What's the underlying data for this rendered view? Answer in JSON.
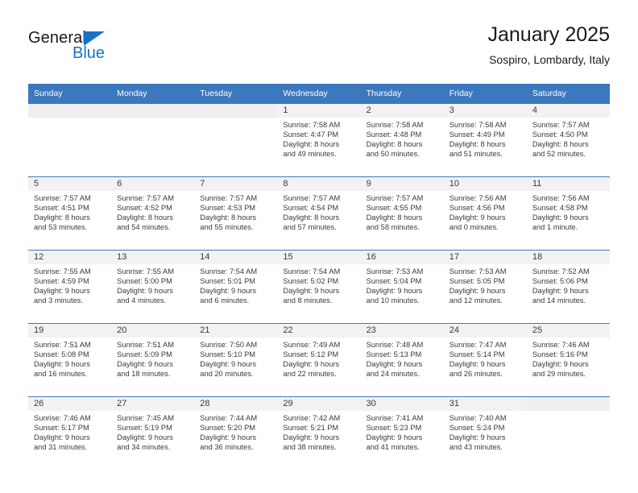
{
  "brand": {
    "name_part1": "General",
    "name_part2": "Blue",
    "triangle_color": "#1a72c4"
  },
  "header": {
    "title": "January 2025",
    "subtitle": "Sospiro, Lombardy, Italy"
  },
  "theme": {
    "header_blue": "#3b78be",
    "daynum_bg": "#f2f2f2",
    "empty_daynum_bg": "#efefef",
    "text": "#3a3a3a"
  },
  "weekdays": [
    "Sunday",
    "Monday",
    "Tuesday",
    "Wednesday",
    "Thursday",
    "Friday",
    "Saturday"
  ],
  "labels": {
    "sunrise_prefix": "Sunrise:",
    "sunset_prefix": "Sunset:",
    "daylight_prefix": "Daylight:"
  },
  "weeks": [
    [
      {
        "day": "",
        "empty": true
      },
      {
        "day": "",
        "empty": true
      },
      {
        "day": "",
        "empty": true
      },
      {
        "day": "1",
        "sunrise": "Sunrise: 7:58 AM",
        "sunset": "Sunset: 4:47 PM",
        "daylight_line1": "Daylight: 8 hours",
        "daylight_line2": "and 49 minutes."
      },
      {
        "day": "2",
        "sunrise": "Sunrise: 7:58 AM",
        "sunset": "Sunset: 4:48 PM",
        "daylight_line1": "Daylight: 8 hours",
        "daylight_line2": "and 50 minutes."
      },
      {
        "day": "3",
        "sunrise": "Sunrise: 7:58 AM",
        "sunset": "Sunset: 4:49 PM",
        "daylight_line1": "Daylight: 8 hours",
        "daylight_line2": "and 51 minutes."
      },
      {
        "day": "4",
        "sunrise": "Sunrise: 7:57 AM",
        "sunset": "Sunset: 4:50 PM",
        "daylight_line1": "Daylight: 8 hours",
        "daylight_line2": "and 52 minutes."
      }
    ],
    [
      {
        "day": "5",
        "sunrise": "Sunrise: 7:57 AM",
        "sunset": "Sunset: 4:51 PM",
        "daylight_line1": "Daylight: 8 hours",
        "daylight_line2": "and 53 minutes."
      },
      {
        "day": "6",
        "sunrise": "Sunrise: 7:57 AM",
        "sunset": "Sunset: 4:52 PM",
        "daylight_line1": "Daylight: 8 hours",
        "daylight_line2": "and 54 minutes."
      },
      {
        "day": "7",
        "sunrise": "Sunrise: 7:57 AM",
        "sunset": "Sunset: 4:53 PM",
        "daylight_line1": "Daylight: 8 hours",
        "daylight_line2": "and 55 minutes."
      },
      {
        "day": "8",
        "sunrise": "Sunrise: 7:57 AM",
        "sunset": "Sunset: 4:54 PM",
        "daylight_line1": "Daylight: 8 hours",
        "daylight_line2": "and 57 minutes."
      },
      {
        "day": "9",
        "sunrise": "Sunrise: 7:57 AM",
        "sunset": "Sunset: 4:55 PM",
        "daylight_line1": "Daylight: 8 hours",
        "daylight_line2": "and 58 minutes."
      },
      {
        "day": "10",
        "sunrise": "Sunrise: 7:56 AM",
        "sunset": "Sunset: 4:56 PM",
        "daylight_line1": "Daylight: 9 hours",
        "daylight_line2": "and 0 minutes."
      },
      {
        "day": "11",
        "sunrise": "Sunrise: 7:56 AM",
        "sunset": "Sunset: 4:58 PM",
        "daylight_line1": "Daylight: 9 hours",
        "daylight_line2": "and 1 minute."
      }
    ],
    [
      {
        "day": "12",
        "sunrise": "Sunrise: 7:55 AM",
        "sunset": "Sunset: 4:59 PM",
        "daylight_line1": "Daylight: 9 hours",
        "daylight_line2": "and 3 minutes."
      },
      {
        "day": "13",
        "sunrise": "Sunrise: 7:55 AM",
        "sunset": "Sunset: 5:00 PM",
        "daylight_line1": "Daylight: 9 hours",
        "daylight_line2": "and 4 minutes."
      },
      {
        "day": "14",
        "sunrise": "Sunrise: 7:54 AM",
        "sunset": "Sunset: 5:01 PM",
        "daylight_line1": "Daylight: 9 hours",
        "daylight_line2": "and 6 minutes."
      },
      {
        "day": "15",
        "sunrise": "Sunrise: 7:54 AM",
        "sunset": "Sunset: 5:02 PM",
        "daylight_line1": "Daylight: 9 hours",
        "daylight_line2": "and 8 minutes."
      },
      {
        "day": "16",
        "sunrise": "Sunrise: 7:53 AM",
        "sunset": "Sunset: 5:04 PM",
        "daylight_line1": "Daylight: 9 hours",
        "daylight_line2": "and 10 minutes."
      },
      {
        "day": "17",
        "sunrise": "Sunrise: 7:53 AM",
        "sunset": "Sunset: 5:05 PM",
        "daylight_line1": "Daylight: 9 hours",
        "daylight_line2": "and 12 minutes."
      },
      {
        "day": "18",
        "sunrise": "Sunrise: 7:52 AM",
        "sunset": "Sunset: 5:06 PM",
        "daylight_line1": "Daylight: 9 hours",
        "daylight_line2": "and 14 minutes."
      }
    ],
    [
      {
        "day": "19",
        "sunrise": "Sunrise: 7:51 AM",
        "sunset": "Sunset: 5:08 PM",
        "daylight_line1": "Daylight: 9 hours",
        "daylight_line2": "and 16 minutes."
      },
      {
        "day": "20",
        "sunrise": "Sunrise: 7:51 AM",
        "sunset": "Sunset: 5:09 PM",
        "daylight_line1": "Daylight: 9 hours",
        "daylight_line2": "and 18 minutes."
      },
      {
        "day": "21",
        "sunrise": "Sunrise: 7:50 AM",
        "sunset": "Sunset: 5:10 PM",
        "daylight_line1": "Daylight: 9 hours",
        "daylight_line2": "and 20 minutes."
      },
      {
        "day": "22",
        "sunrise": "Sunrise: 7:49 AM",
        "sunset": "Sunset: 5:12 PM",
        "daylight_line1": "Daylight: 9 hours",
        "daylight_line2": "and 22 minutes."
      },
      {
        "day": "23",
        "sunrise": "Sunrise: 7:48 AM",
        "sunset": "Sunset: 5:13 PM",
        "daylight_line1": "Daylight: 9 hours",
        "daylight_line2": "and 24 minutes."
      },
      {
        "day": "24",
        "sunrise": "Sunrise: 7:47 AM",
        "sunset": "Sunset: 5:14 PM",
        "daylight_line1": "Daylight: 9 hours",
        "daylight_line2": "and 26 minutes."
      },
      {
        "day": "25",
        "sunrise": "Sunrise: 7:46 AM",
        "sunset": "Sunset: 5:16 PM",
        "daylight_line1": "Daylight: 9 hours",
        "daylight_line2": "and 29 minutes."
      }
    ],
    [
      {
        "day": "26",
        "sunrise": "Sunrise: 7:46 AM",
        "sunset": "Sunset: 5:17 PM",
        "daylight_line1": "Daylight: 9 hours",
        "daylight_line2": "and 31 minutes."
      },
      {
        "day": "27",
        "sunrise": "Sunrise: 7:45 AM",
        "sunset": "Sunset: 5:19 PM",
        "daylight_line1": "Daylight: 9 hours",
        "daylight_line2": "and 34 minutes."
      },
      {
        "day": "28",
        "sunrise": "Sunrise: 7:44 AM",
        "sunset": "Sunset: 5:20 PM",
        "daylight_line1": "Daylight: 9 hours",
        "daylight_line2": "and 36 minutes."
      },
      {
        "day": "29",
        "sunrise": "Sunrise: 7:42 AM",
        "sunset": "Sunset: 5:21 PM",
        "daylight_line1": "Daylight: 9 hours",
        "daylight_line2": "and 38 minutes."
      },
      {
        "day": "30",
        "sunrise": "Sunrise: 7:41 AM",
        "sunset": "Sunset: 5:23 PM",
        "daylight_line1": "Daylight: 9 hours",
        "daylight_line2": "and 41 minutes."
      },
      {
        "day": "31",
        "sunrise": "Sunrise: 7:40 AM",
        "sunset": "Sunset: 5:24 PM",
        "daylight_line1": "Daylight: 9 hours",
        "daylight_line2": "and 43 minutes."
      },
      {
        "day": "",
        "empty": true
      }
    ]
  ]
}
